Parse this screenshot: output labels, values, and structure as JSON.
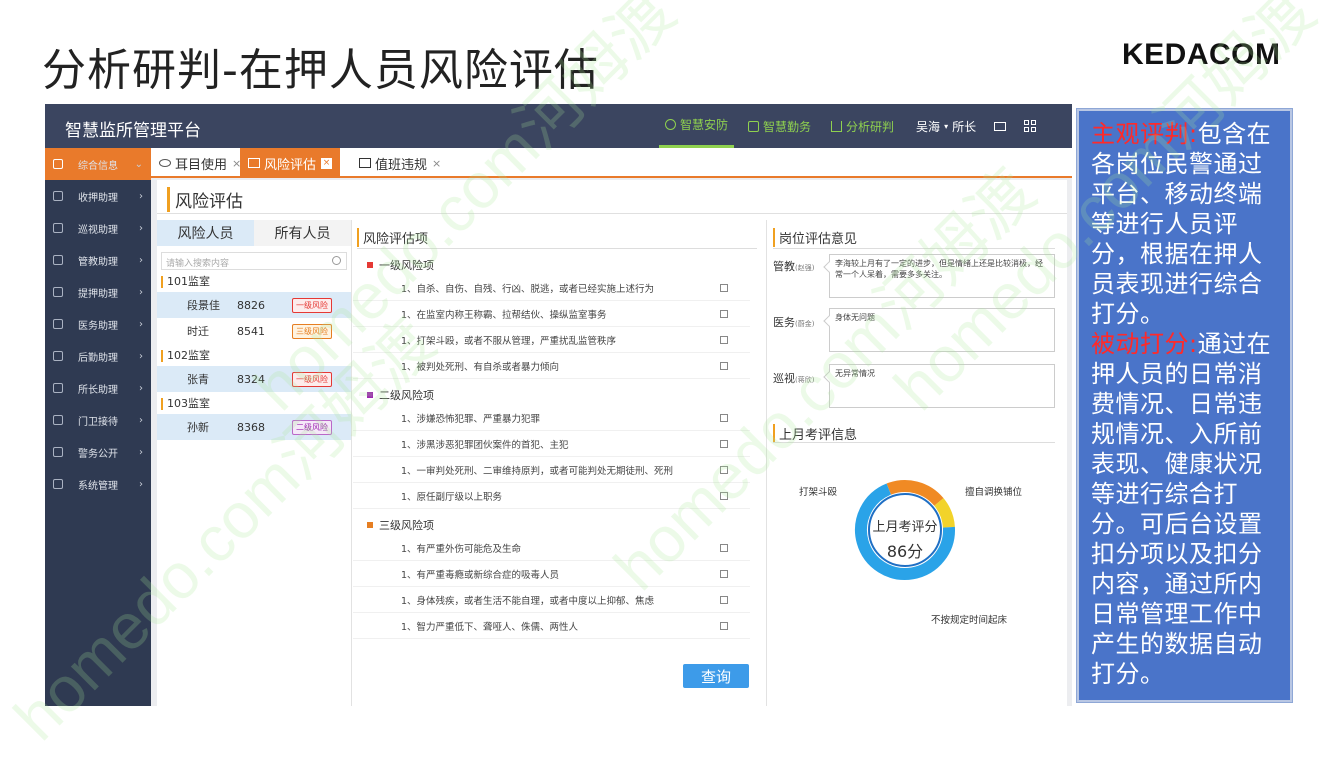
{
  "slide": {
    "title": "分析研判-在押人员风险评估",
    "brand": "KEDACOM",
    "watermark_text": "homedo.com河姆渡"
  },
  "app": {
    "title": "智慧监所管理平台",
    "nav": [
      {
        "label": "智慧安防",
        "active": true
      },
      {
        "label": "智慧勤务",
        "active": false
      },
      {
        "label": "分析研判",
        "active": false
      }
    ],
    "user": "吴海",
    "role": "所长",
    "colors": {
      "topbar": "#3b4560",
      "sidebar": "#2f3a52",
      "accent": "#e97a2b",
      "nav_green": "#8fd14f",
      "button": "#3d9be9"
    }
  },
  "sidebar": {
    "items": [
      {
        "label": "综合信息",
        "active": true
      },
      {
        "label": "收押助理"
      },
      {
        "label": "巡视助理"
      },
      {
        "label": "管教助理"
      },
      {
        "label": "提押助理"
      },
      {
        "label": "医务助理"
      },
      {
        "label": "后勤助理"
      },
      {
        "label": "所长助理"
      },
      {
        "label": "门卫接待"
      },
      {
        "label": "警务公开"
      },
      {
        "label": "系统管理"
      }
    ]
  },
  "tabs": [
    {
      "label": "耳目使用",
      "active": false
    },
    {
      "label": "风险评估",
      "active": true
    },
    {
      "label": "值班违规",
      "active": false
    }
  ],
  "page": {
    "title": "风险评估"
  },
  "people_panel": {
    "tabs": [
      "风险人员",
      "所有人员"
    ],
    "search_placeholder": "请输入搜索内容",
    "rooms": [
      {
        "name": "101监室",
        "people": [
          {
            "name": "段景佳",
            "id": "8826",
            "level": "一级风险",
            "selected": true
          },
          {
            "name": "时迁",
            "id": "8541",
            "level": "三级风险"
          }
        ]
      },
      {
        "name": "102监室",
        "people": [
          {
            "name": "张青",
            "id": "8324",
            "level": "一级风险",
            "selected": true
          }
        ]
      },
      {
        "name": "103监室",
        "people": [
          {
            "name": "孙新",
            "id": "8368",
            "level": "二级风险",
            "selected": true
          }
        ]
      }
    ]
  },
  "assessment": {
    "title": "风险评估项",
    "groups": [
      {
        "label": "一级风险项",
        "color": "#e53935",
        "items": [
          "1、自杀、自伤、自残、行凶、脱逃，或者已经实施上述行为",
          "1、在监室内称王称霸、拉帮结伙、操纵监室事务",
          "1、打架斗殴，或者不服从管理，严重扰乱监管秩序",
          "1、被判处死刑、有自杀或者暴力倾向"
        ]
      },
      {
        "label": "二级风险项",
        "color": "#9c27b0",
        "items": [
          "1、涉嫌恐怖犯罪、严重暴力犯罪",
          "1、涉黑涉恶犯罪团伙案件的首犯、主犯",
          "1、一审判处死刑、二审维持原判，或者可能判处无期徒刑、死刑",
          "1、原任副厅级以上职务"
        ]
      },
      {
        "label": "三级风险项",
        "color": "#e67e22",
        "items": [
          "1、有严重外伤可能危及生命",
          "1、有严重毒瘾或新综合症的吸毒人员",
          "1、身体残疾，或者生活不能自理，或者中度以上抑郁、焦虑",
          "1、智力严重低下、聋哑人、侏儒、两性人"
        ]
      }
    ],
    "query_label": "查询"
  },
  "opinions": {
    "title": "岗位评估意见",
    "items": [
      {
        "role": "管教",
        "person": "(赵强)",
        "text": "李海较上月有了一定的进步，但是情绪上还是比较消极，经常一个人呆着，需要多多关注。"
      },
      {
        "role": "医务",
        "person": "(蔚金)",
        "text": "身体无问题"
      },
      {
        "role": "巡视",
        "person": "(蒋欣)",
        "text": "无异常情况"
      }
    ]
  },
  "last_month": {
    "title": "上月考评信息",
    "score_label": "上月考评分",
    "score": "86分",
    "segments": [
      {
        "label": "打架斗殴",
        "color": "#f08a24",
        "share": 0.2
      },
      {
        "label": "擅自调换铺位",
        "color": "#f2d32a",
        "share": 0.1
      },
      {
        "label": "不按规定时间起床",
        "color": "#2aa3e8",
        "share": 0.7
      }
    ]
  },
  "note": {
    "part1_head": "主观评判:",
    "part1_body": "包含在各岗位民警通过平台、移动终端等进行人员评分，根据在押人员表现进行综合打分。",
    "part2_head": "被动打分:",
    "part2_body": "通过在押人员的日常消费情况、日常违规情况、入所前表现、健康状况等进行综合打分。可后台设置扣分项以及扣分内容，通过所内日常管理工作中产生的数据自动打分。"
  }
}
